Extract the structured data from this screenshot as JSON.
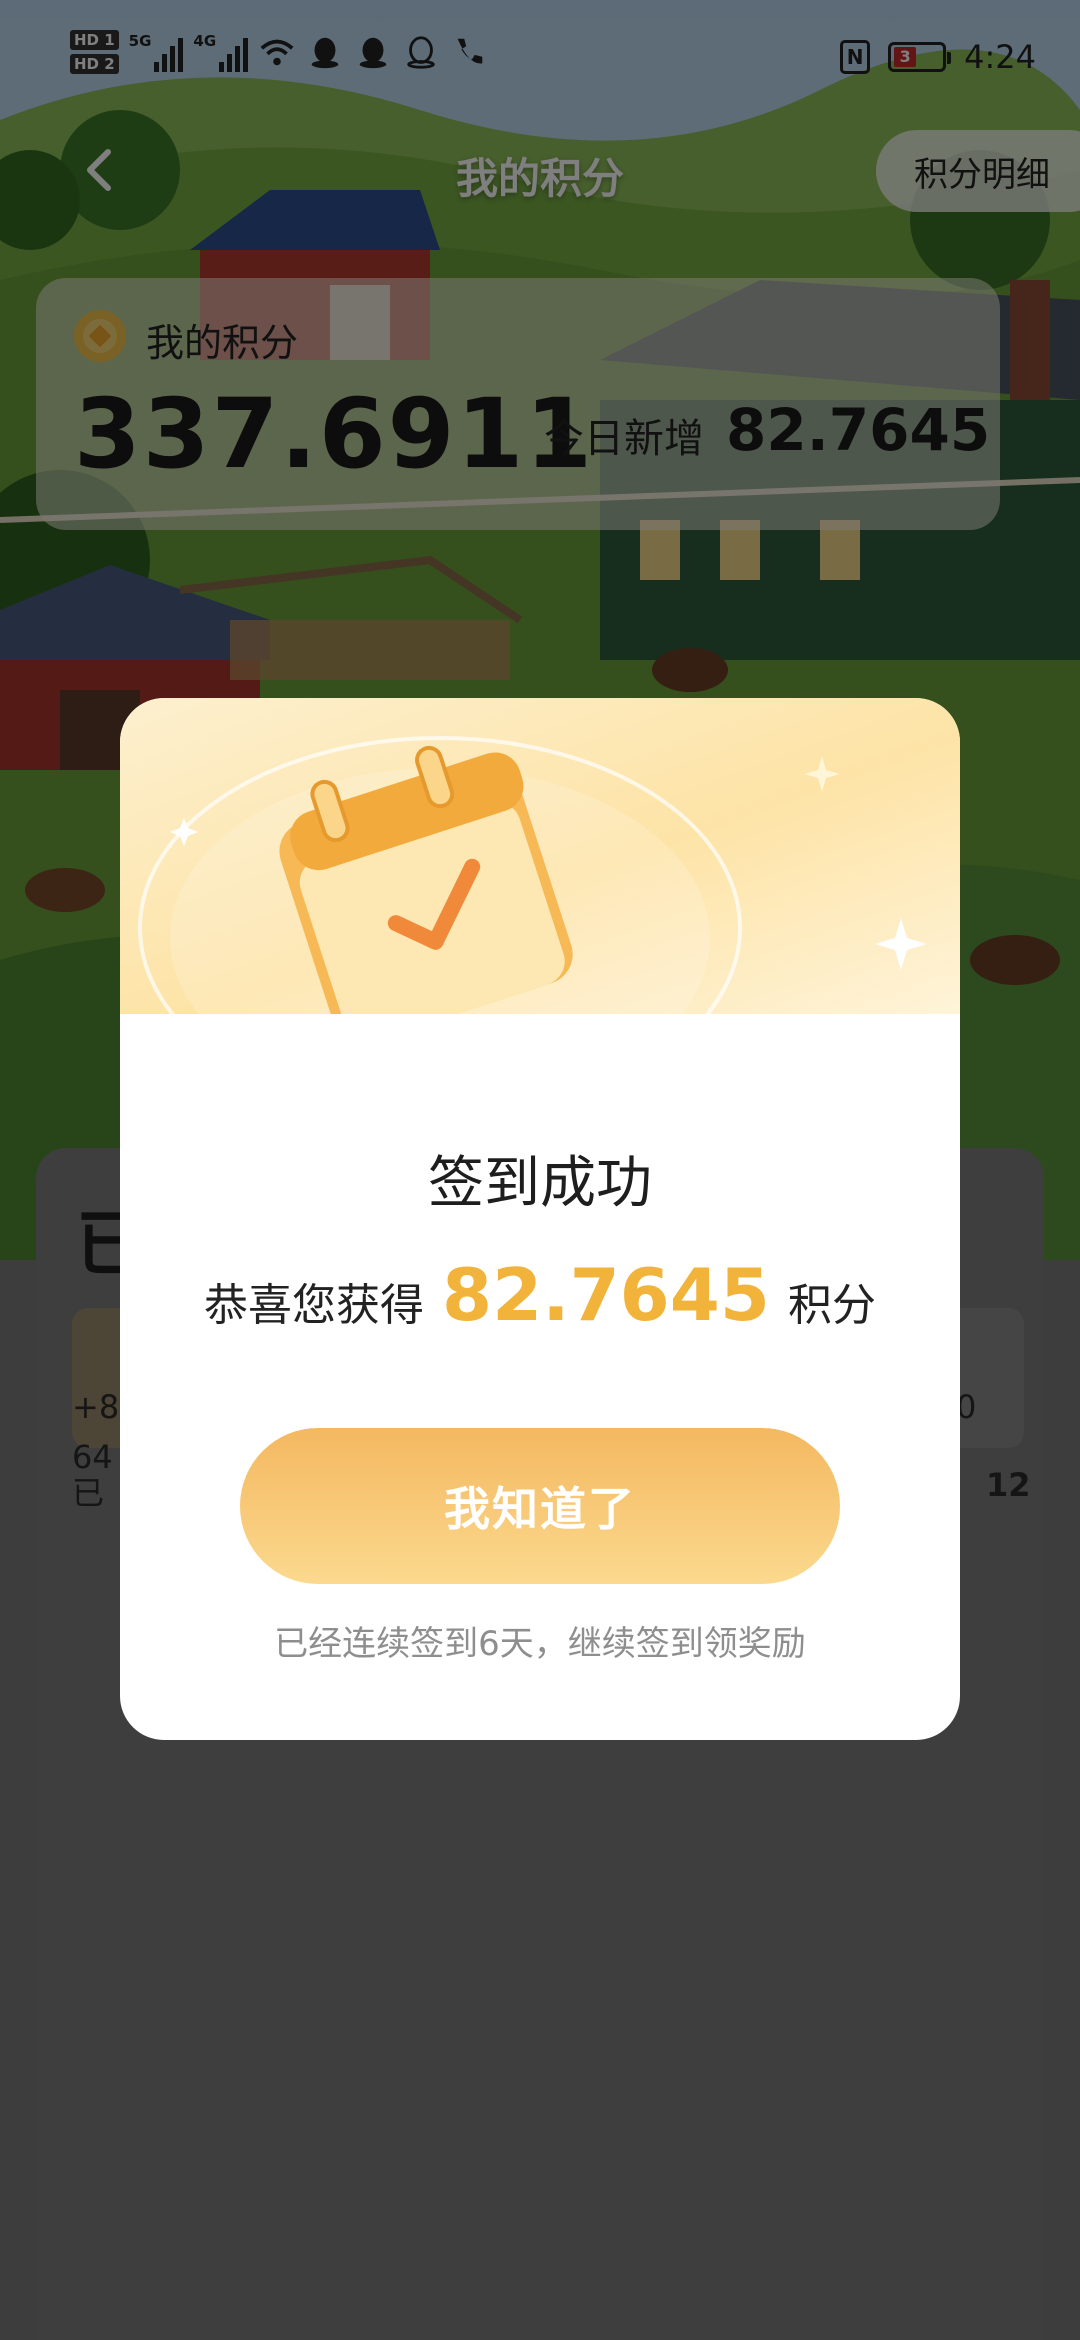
{
  "status_bar": {
    "hd1": "HD 1",
    "hd2": "HD 2",
    "net1": "5G",
    "net2": "4G",
    "battery_level": "3",
    "time": "4:24"
  },
  "nav": {
    "title": "我的积分",
    "detail_button": "积分明细"
  },
  "points_card": {
    "label": "我的积分",
    "total": "337.6911",
    "today_label": "今日新增",
    "today_value": "82.7645"
  },
  "sheet": {
    "title_partial": "已",
    "left_card_line1": "+8",
    "left_card_line2": "64",
    "left_card_line3": "已",
    "right_card_line1": "0",
    "right_card_line2": "12"
  },
  "dialog": {
    "title": "签到成功",
    "reward_prefix": "恭喜您获得",
    "reward_value": "82.7645",
    "reward_suffix": "积分",
    "confirm_button": "我知道了",
    "streak_text": "已经连续签到6天，继续签到领奖励"
  },
  "colors": {
    "accent_gold": "#f2b33a",
    "button_gradient_top": "#f4b860",
    "button_gradient_bottom": "#fbd98e"
  }
}
